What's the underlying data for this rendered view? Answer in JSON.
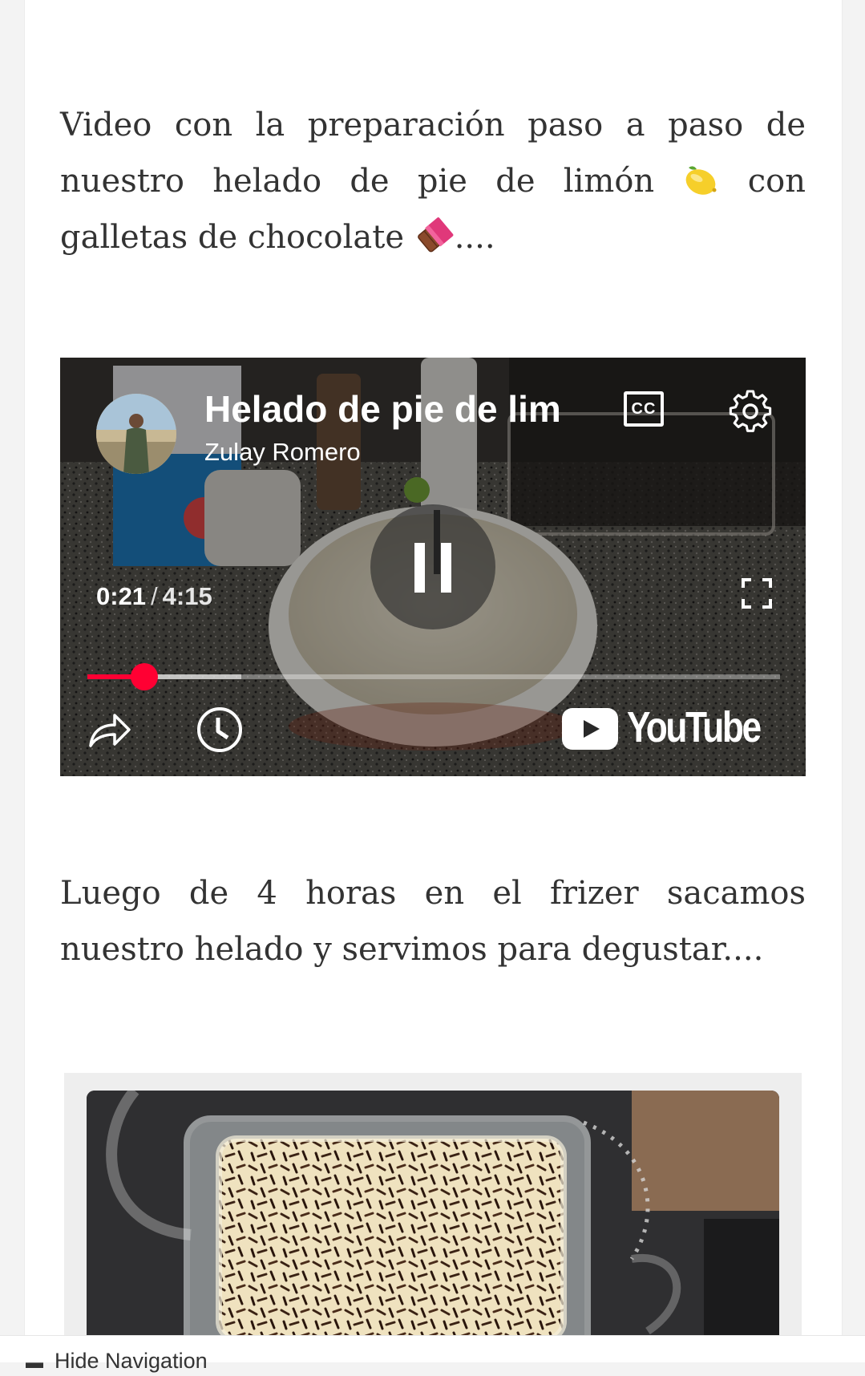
{
  "article": {
    "paragraph1_text_a": "Video con la preparación paso a paso de nuestro helado de pie de limón",
    "paragraph1_text_b": " con galletas de chocolate",
    "paragraph1_text_c": "....",
    "paragraph1_emoji_1": "lemon-emoji",
    "paragraph1_emoji_2": "chocolate-bar-emoji",
    "paragraph2_text": "Luego de 4 horas en el frizer sacamos nuestro helado y servimos para degustar...."
  },
  "video": {
    "title": "Helado de pie de limón con galletas de chocolate",
    "channel": "Zulay Romero",
    "current_time": "0:21",
    "time_separator": "/",
    "duration": "4:15",
    "cc_label": "CC",
    "played_fraction": 0.0824,
    "buffered_fraction": 0.2222,
    "brand_word": "YouTube",
    "accent_color": "#ff0033",
    "icons": [
      "captions-icon",
      "settings-gear-icon",
      "pause-icon",
      "fullscreen-icon",
      "share-icon",
      "watch-later-icon",
      "youtube-logo-icon"
    ]
  },
  "footer": {
    "hide_nav_caret": "▬",
    "hide_nav_label": "Hide Navigation"
  }
}
